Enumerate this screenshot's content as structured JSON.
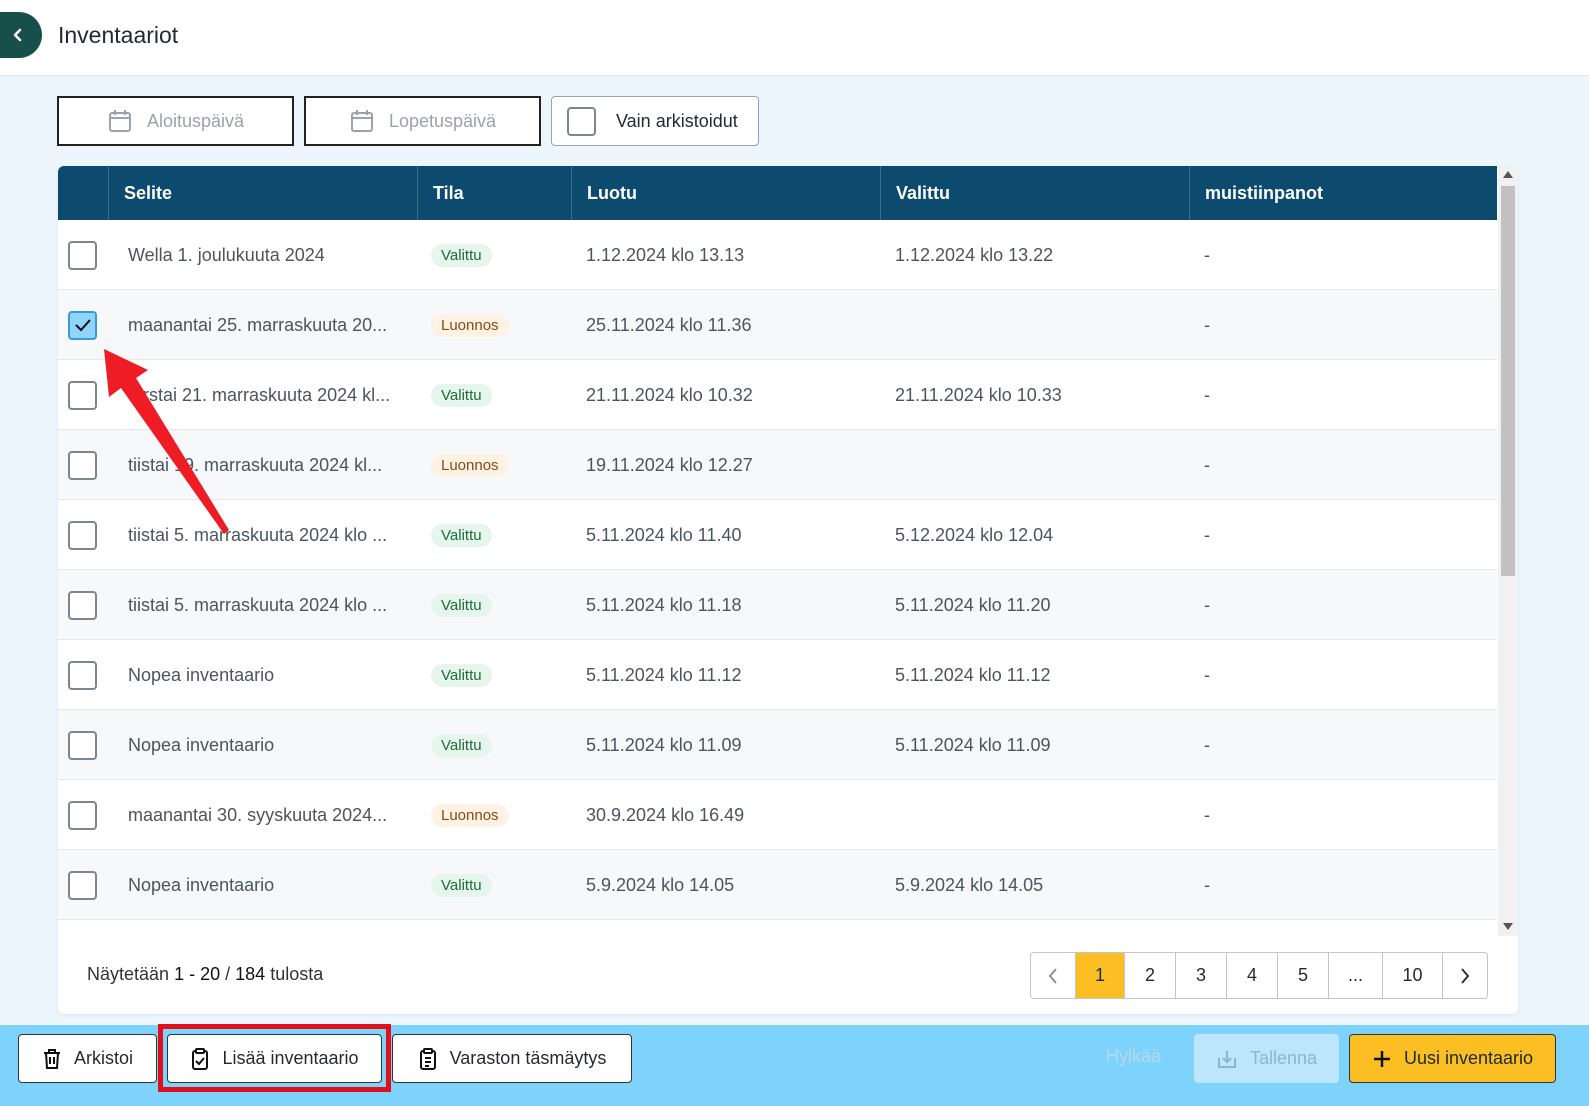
{
  "header": {
    "title": "Inventaariot"
  },
  "filters": {
    "start_date_label": "Aloituspäivä",
    "end_date_label": "Lopetuspäivä",
    "archived_only_label": "Vain arkistoidut"
  },
  "table": {
    "columns": [
      "Selite",
      "Tila",
      "Luotu",
      "Valittu",
      "muistiinpanot"
    ],
    "rows": [
      {
        "checked": false,
        "selite": "Wella 1. joulukuuta 2024",
        "tila": "Valittu",
        "luotu": "1.12.2024 klo 13.13",
        "valittu": "1.12.2024 klo 13.22",
        "muist": "-"
      },
      {
        "checked": true,
        "selite": "maanantai 25. marraskuuta 20...",
        "tila": "Luonnos",
        "luotu": "25.11.2024 klo 11.36",
        "valittu": "",
        "muist": "-"
      },
      {
        "checked": false,
        "selite": "torstai 21. marraskuuta 2024 kl...",
        "tila": "Valittu",
        "luotu": "21.11.2024 klo 10.32",
        "valittu": "21.11.2024 klo 10.33",
        "muist": "-"
      },
      {
        "checked": false,
        "selite": "tiistai 19. marraskuuta 2024 kl...",
        "tila": "Luonnos",
        "luotu": "19.11.2024 klo 12.27",
        "valittu": "",
        "muist": "-"
      },
      {
        "checked": false,
        "selite": "tiistai 5. marraskuuta 2024 klo ...",
        "tila": "Valittu",
        "luotu": "5.11.2024 klo 11.40",
        "valittu": "5.12.2024 klo 12.04",
        "muist": "-"
      },
      {
        "checked": false,
        "selite": "tiistai 5. marraskuuta 2024 klo ...",
        "tila": "Valittu",
        "luotu": "5.11.2024 klo 11.18",
        "valittu": "5.11.2024 klo 11.20",
        "muist": "-"
      },
      {
        "checked": false,
        "selite": "Nopea inventaario",
        "tila": "Valittu",
        "luotu": "5.11.2024 klo 11.12",
        "valittu": "5.11.2024 klo 11.12",
        "muist": "-"
      },
      {
        "checked": false,
        "selite": "Nopea inventaario",
        "tila": "Valittu",
        "luotu": "5.11.2024 klo 11.09",
        "valittu": "5.11.2024 klo 11.09",
        "muist": "-"
      },
      {
        "checked": false,
        "selite": "maanantai 30. syyskuuta 2024...",
        "tila": "Luonnos",
        "luotu": "30.9.2024 klo 16.49",
        "valittu": "",
        "muist": "-"
      },
      {
        "checked": false,
        "selite": "Nopea inventaario",
        "tila": "Valittu",
        "luotu": "5.9.2024 klo 14.05",
        "valittu": "5.9.2024 klo 14.05",
        "muist": "-"
      }
    ]
  },
  "footer": {
    "prefix": "Näytetään",
    "range": "1 - 20",
    "separator": "/",
    "total": "184",
    "suffix": "tulosta"
  },
  "pagination": {
    "prev_icon": "chevron-left-icon",
    "pages": [
      "1",
      "2",
      "3",
      "4",
      "5",
      "...",
      "10"
    ],
    "current": "1",
    "next_icon": "chevron-right-icon"
  },
  "actions": {
    "archive_label": "Arkistoi",
    "add_inventory_label": "Lisää inventaario",
    "reconcile_label": "Varaston täsmäytys",
    "reject_label": "Hylkää",
    "save_label": "Tallenna",
    "new_inventory_label": "Uusi inventaario"
  },
  "colors": {
    "header_bg": "#0c4a6e",
    "accent": "#fbbf24",
    "bottom_bar": "#7dd3fc",
    "annotation": "#e0101a",
    "back_button": "#17504a"
  }
}
